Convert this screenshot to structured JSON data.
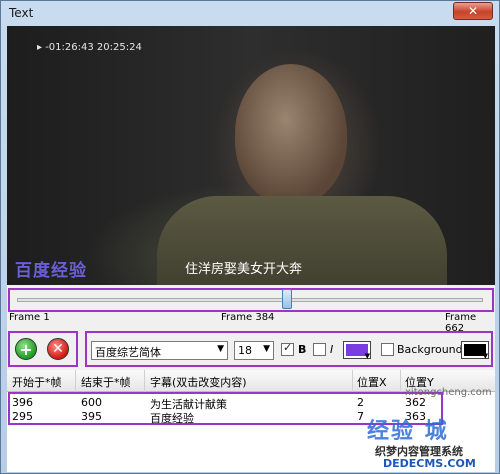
{
  "window": {
    "title": "Text",
    "close_glyph": "✕"
  },
  "video": {
    "osd_time": "▸  -01:26:43  20:25:24",
    "watermark": "百度经验",
    "subtitle": "住洋房娶美女开大奔"
  },
  "timeline": {
    "start_label": "Frame 1",
    "current_label": "Frame 384",
    "end_label": "Frame 662",
    "position_fraction": 0.58
  },
  "toolbar": {
    "add_icon": "plus-icon",
    "delete_icon": "delete-icon",
    "font_name": "百度综艺简体",
    "font_size": "18",
    "bold_label": "B",
    "bold_checked": true,
    "italic_label": "I",
    "italic_checked": false,
    "text_color": "#7a3de0",
    "background_label": "Background:",
    "background_checked": false,
    "background_color": "#000000"
  },
  "table": {
    "headers": [
      "开始于*帧",
      "结束于*帧",
      "字幕(双击改变内容)",
      "位置X",
      "位置Y"
    ],
    "rows": [
      [
        "396",
        "600",
        "为生活献计献策",
        "2",
        "362"
      ],
      [
        "295",
        "395",
        "百度经验",
        "7",
        "363"
      ]
    ]
  },
  "site_logo": {
    "big": "经验 城",
    "line1": "织梦内容管理系统",
    "line2": "DEDECMS.COM",
    "line3": "xitongcheng.com"
  },
  "colors": {
    "highlight": "#9b35c8"
  }
}
